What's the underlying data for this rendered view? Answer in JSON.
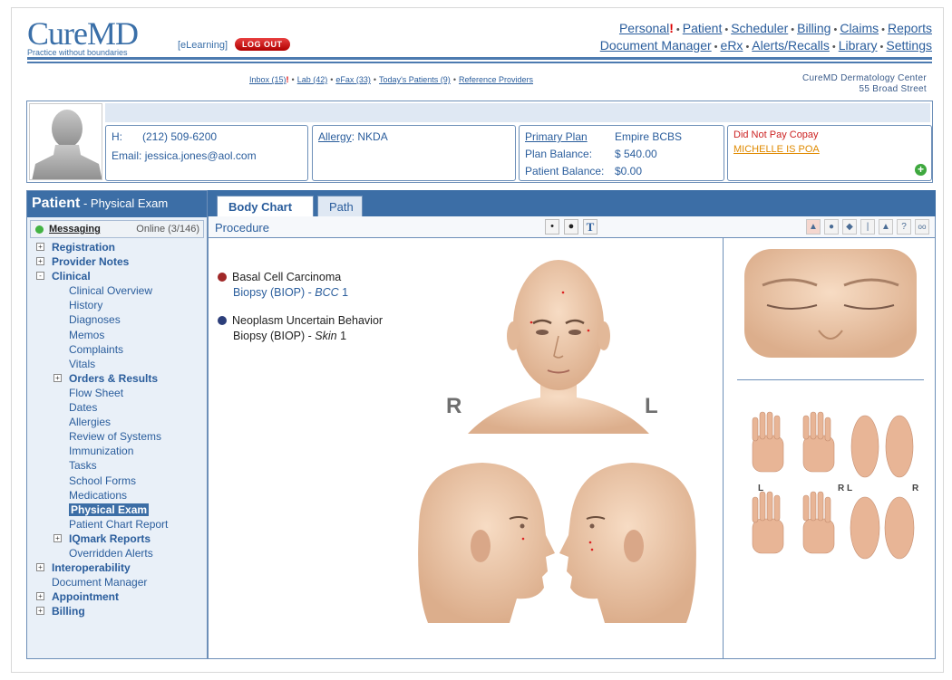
{
  "app": {
    "logo_text": "CureMD",
    "logo_tagline": "Practice without boundaries",
    "elearning": "[eLearning]",
    "logout": "LOG OUT"
  },
  "topnav": {
    "row1": [
      "Personal",
      "Patient",
      "Scheduler",
      "Billing",
      "Claims",
      "Reports"
    ],
    "row2": [
      "Document Manager",
      "eRx",
      "Alerts/Recalls",
      "Library",
      "Settings"
    ],
    "personal_alert": "!"
  },
  "shortcuts": {
    "inbox": "Inbox (15)",
    "inbox_alert": "!",
    "lab": "Lab (42)",
    "efax": "eFax (33)",
    "todays": "Today's Patients (9)",
    "reference": "Reference Providers"
  },
  "clinic": {
    "name": "CureMD Dermatology Center",
    "address": "55 Broad Street"
  },
  "patient": {
    "phone_label": "H:",
    "phone": "(212) 509-6200",
    "email_label": "Email:",
    "email": "jessica.jones@aol.com",
    "allergy_label": "Allergy",
    "allergy_value": ": NKDA",
    "primary_plan_label": "Primary Plan",
    "primary_plan": "Empire BCBS",
    "plan_balance_label": "Plan Balance:",
    "plan_balance": "$ 540.00",
    "patient_balance_label": "Patient Balance:",
    "patient_balance": "$0.00",
    "alert1": "Did Not Pay Copay",
    "alert2": "MICHELLE IS POA"
  },
  "left": {
    "title": "Patient",
    "subtitle": " - Physical Exam",
    "messaging": "Messaging",
    "online": "Online (3/146)",
    "tree": [
      {
        "label": "Registration",
        "level": 0,
        "toggle": "+"
      },
      {
        "label": "Provider Notes",
        "level": 0,
        "toggle": "+"
      },
      {
        "label": "Clinical",
        "level": 0,
        "toggle": "-"
      },
      {
        "label": "Clinical Overview",
        "level": 1
      },
      {
        "label": "History",
        "level": 1
      },
      {
        "label": "Diagnoses",
        "level": 1
      },
      {
        "label": "Memos",
        "level": 1
      },
      {
        "label": "Complaints",
        "level": 1
      },
      {
        "label": "Vitals",
        "level": 1
      },
      {
        "label": "Orders & Results",
        "level": 1,
        "toggle": "+",
        "bold": true
      },
      {
        "label": "Flow Sheet",
        "level": 1
      },
      {
        "label": "Dates",
        "level": 1
      },
      {
        "label": "Allergies",
        "level": 1
      },
      {
        "label": "Review of Systems",
        "level": 1
      },
      {
        "label": "Immunization",
        "level": 1
      },
      {
        "label": "Tasks",
        "level": 1
      },
      {
        "label": "School Forms",
        "level": 1
      },
      {
        "label": "Medications",
        "level": 1
      },
      {
        "label": "Physical Exam",
        "level": 1,
        "selected": true
      },
      {
        "label": "Patient Chart Report",
        "level": 1
      },
      {
        "label": "IQmark Reports",
        "level": 1,
        "toggle": "+",
        "bold": true
      },
      {
        "label": "Overridden Alerts",
        "level": 1
      },
      {
        "label": "Interoperability",
        "level": 0,
        "toggle": "+"
      },
      {
        "label": "Document Manager",
        "level": 0,
        "plain": true
      },
      {
        "label": "Appointment",
        "level": 0,
        "toggle": "+"
      },
      {
        "label": "Billing",
        "level": 0,
        "toggle": "+"
      }
    ]
  },
  "tabs": {
    "body_chart": "Body Chart",
    "path": "Path"
  },
  "procedure_label": "Procedure",
  "tools": {
    "dot_small": "•",
    "dot_large": "●",
    "text_tool": "T"
  },
  "diagnoses": [
    {
      "name": "Basal Cell Carcinoma",
      "procedure": "Biopsy (BIOP) - ",
      "site": "BCC",
      "count": " 1",
      "color": "#a02828"
    },
    {
      "name": "Neoplasm Uncertain Behavior",
      "procedure": "Biopsy (BIOP) - ",
      "site": "Skin",
      "count": " 1",
      "color": "#2c3e7a"
    }
  ],
  "chart_labels": {
    "right": "R",
    "left": "L",
    "hand_l1": "L",
    "hand_r1": "R",
    "hand_l2": "L",
    "hand_r2": "R"
  }
}
